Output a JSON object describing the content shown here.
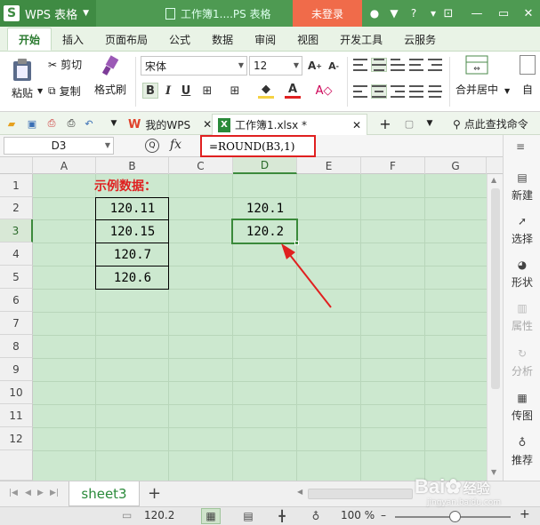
{
  "titlebar": {
    "app_name": "WPS 表格",
    "doc_title": "工作簿1....PS 表格",
    "login": "未登录"
  },
  "ribbon_tabs": [
    "开始",
    "插入",
    "页面布局",
    "公式",
    "数据",
    "审阅",
    "视图",
    "开发工具",
    "云服务"
  ],
  "ribbon": {
    "paste": "粘贴",
    "cut": "剪切",
    "copy": "复制",
    "format_painter": "格式刷",
    "font_name": "宋体",
    "font_size": "12",
    "merge_center": "合并居中",
    "wrap": "自"
  },
  "qbar": {
    "my_wps": "我的WPS",
    "workbook_tab": "工作簿1.xlsx *",
    "search": "点此查找命令"
  },
  "formula_bar": {
    "name_box": "D3",
    "fx": "fx",
    "formula": "=ROUND(B3,1)"
  },
  "columns": [
    "A",
    "B",
    "C",
    "D",
    "E",
    "F",
    "G"
  ],
  "rows": [
    "1",
    "2",
    "3",
    "4",
    "5",
    "6",
    "7",
    "8",
    "9",
    "10",
    "11",
    "12"
  ],
  "cells": {
    "B1": "示例数据：",
    "B2": "120.11",
    "B3": "120.15",
    "B4": "120.7",
    "B5": "120.6",
    "D2": "120.1",
    "D3": "120.2"
  },
  "side_panel": [
    "新建",
    "选择",
    "形状",
    "属性",
    "分析",
    "传图",
    "推荐"
  ],
  "sheet_tab": "sheet3",
  "status": {
    "value": "120.2",
    "zoom": "100 %"
  },
  "watermark": {
    "main": "Bai",
    "brand": "经验",
    "sub": "jingyan.baidu.com"
  },
  "colors": {
    "accent": "#4e9a52",
    "grid_bg": "#cce8cf",
    "highlight_red": "#e02020",
    "login_bg": "#f06b4a"
  }
}
